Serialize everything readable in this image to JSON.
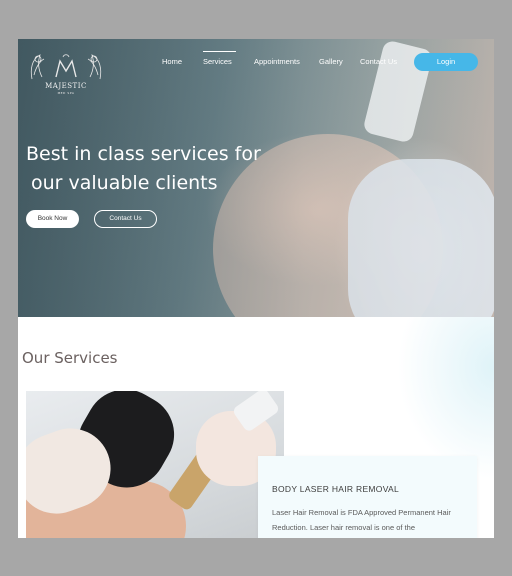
{
  "brand": {
    "name": "MAJESTIC",
    "tagline": "MED SPA"
  },
  "nav": {
    "items": [
      {
        "label": "Home"
      },
      {
        "label": "Services"
      },
      {
        "label": "Appointments"
      },
      {
        "label": "Gallery"
      },
      {
        "label": "Contact  Us"
      }
    ],
    "active": "Services",
    "login_label": "Login"
  },
  "hero": {
    "title_line1": "Best in class services for",
    "title_line2": "our valuable clients",
    "book_label": "Book Now",
    "contact_label": "Contact Us"
  },
  "services": {
    "heading": "Our Services",
    "card": {
      "title": "BODY LASER HAIR REMOVAL",
      "text": "Laser Hair Removal is FDA Approved Permanent Hair Reduction. Laser hair removal is one of the"
    }
  },
  "colors": {
    "accent": "#46b7e8",
    "page_bg": "#a7a7a7",
    "heading_text": "#6b6160"
  },
  "icons": {
    "logo": "peacock-crest-logo"
  }
}
